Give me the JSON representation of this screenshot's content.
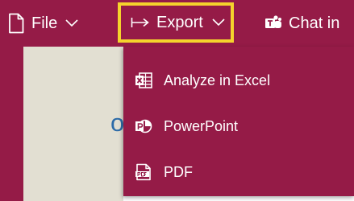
{
  "toolbar": {
    "file_label": "File",
    "export_label": "Export",
    "chat_label": "Chat in"
  },
  "background": {
    "partial_text": "oc"
  },
  "export_menu": {
    "items": [
      {
        "label": "Analyze in Excel",
        "icon": "excel-icon"
      },
      {
        "label": "PowerPoint",
        "icon": "powerpoint-icon"
      },
      {
        "label": "PDF",
        "icon": "pdf-icon"
      }
    ]
  },
  "colors": {
    "ribbon": "#951b47",
    "highlight_border": "#f5d32c",
    "canvas": "#e2dfd2",
    "background_text": "#2c6ba8"
  }
}
